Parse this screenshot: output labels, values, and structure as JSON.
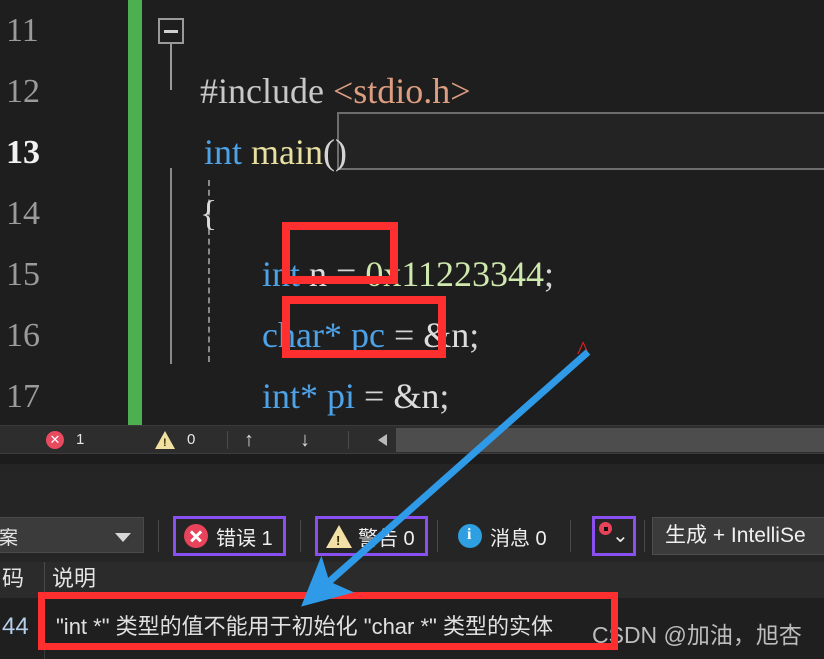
{
  "editor": {
    "line_numbers": [
      "11",
      "12",
      "13",
      "14",
      "15",
      "16",
      "17"
    ],
    "current_line": "13",
    "lines": [
      {
        "num": "11",
        "text": ""
      },
      {
        "num": "12",
        "text": "#include <stdio.h>"
      },
      {
        "num": "13",
        "text": "int main()"
      },
      {
        "num": "14",
        "text": "{"
      },
      {
        "num": "15",
        "text": "int n = 0x11223344;"
      },
      {
        "num": "16",
        "text": "char* pc = &n;"
      },
      {
        "num": "17",
        "text": "int* pi = &n;"
      }
    ],
    "tokens": {
      "include_directive": "#include",
      "include_header": "<stdio.h>",
      "kw_int": "int",
      "fn_main": "main",
      "parens": "()",
      "brace_open": "{",
      "var_n": "n",
      "assign": " = ",
      "hex_literal": "0x11223344",
      "semicolon": ";",
      "kw_char_ptr": "char*",
      "var_pc": "pc",
      "addr_n": "&n",
      "kw_int_ptr": "int*",
      "var_pi": "pi"
    },
    "fold_icon": "collapse-minus-icon",
    "save_indicator_color": "#4caf50",
    "colors": {
      "background": "#1e1e1e",
      "keyword": "#4ea3e8",
      "function": "#e8dfa0",
      "number": "#cfe8ae",
      "string": "#dc9d80",
      "plain": "#dcdcdc",
      "linenumber": "#9b9b9b"
    }
  },
  "editor_statusbar": {
    "error_icon": "error-circle-icon",
    "error_count": "1",
    "warning_icon": "warning-triangle-icon",
    "warning_count": "0",
    "prev_icon": "↑",
    "next_icon": "↓",
    "scroll_left_icon": "scroll-left-arrow-icon"
  },
  "error_list": {
    "scope_dropdown": {
      "value": "案",
      "caret_icon": "chevron-down-icon"
    },
    "buttons": [
      {
        "icon": "error-circle-icon",
        "label": "错误 1",
        "highlighted": true
      },
      {
        "icon": "warning-triangle-icon",
        "label": "警告 0",
        "highlighted": true
      },
      {
        "icon": "info-circle-icon",
        "label": "消息 0",
        "highlighted": false
      }
    ],
    "filter_button": {
      "icon": "filter-funnel-icon",
      "badge_icon": "red-dot-icon",
      "highlighted": true
    },
    "build_filter": {
      "label": "生成 + IntelliSe"
    },
    "columns": [
      "码",
      "说明"
    ],
    "rows": [
      {
        "code": "44",
        "description": "\"int *\" 类型的值不能用于初始化 \"char *\" 类型的实体"
      }
    ]
  },
  "annotations": {
    "red_box_1_target": "int",
    "red_box_2_target": "char*",
    "red_box_3_target": "error-description-text",
    "red_squiggle": "^",
    "arrow_color": "#2f9ae8",
    "red_color": "#ff2f2f",
    "purple_color": "#8a4ff0"
  },
  "watermark": {
    "text": "CSDN @加油，旭杏"
  }
}
